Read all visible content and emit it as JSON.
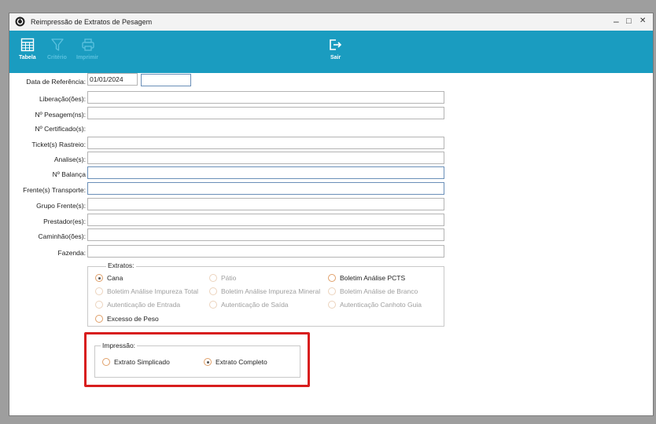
{
  "window": {
    "title": "Reimpressão de Extratos de Pesagem",
    "controls": {
      "minimize": "–",
      "maximize": "□",
      "close": "✕"
    }
  },
  "toolbar": {
    "tabela": "Tabela",
    "criterio": "Critério",
    "imprimir": "Imprimir",
    "sair": "Sair"
  },
  "form": {
    "data_referencia": {
      "label": "Data de Referência:",
      "value": "01/01/2024",
      "value2": ""
    },
    "liberacoes": {
      "label": "Liberação(ões):",
      "value": ""
    },
    "pesagens": {
      "label": "Nº Pesagem(ns):",
      "value": ""
    },
    "certificados": {
      "label": "Nº Certificado(s):"
    },
    "tickets": {
      "label": "Ticket(s) Rastreio:",
      "value": ""
    },
    "analises": {
      "label": "Analise(s):",
      "value": ""
    },
    "balanca": {
      "label": "Nº Balança",
      "value": ""
    },
    "frentes": {
      "label": "Frente(s) Transporte:",
      "value": ""
    },
    "grupo_frentes": {
      "label": "Grupo Frente(s):",
      "value": ""
    },
    "prestadores": {
      "label": "Prestador(es):",
      "value": ""
    },
    "caminhoes": {
      "label": "Caminhão(ões):",
      "value": ""
    },
    "fazenda": {
      "label": "Fazenda:",
      "value": ""
    }
  },
  "extratos": {
    "legend": "Extratos:",
    "options": [
      {
        "label": "Cana",
        "selected": true,
        "enabled": true
      },
      {
        "label": "Pátio",
        "selected": false,
        "enabled": false
      },
      {
        "label": "Boletim Análise PCTS",
        "selected": false,
        "enabled": true
      },
      {
        "label": "Boletim Análise Impureza Total",
        "selected": false,
        "enabled": false
      },
      {
        "label": "Boletim Análise Impureza Mineral",
        "selected": false,
        "enabled": false
      },
      {
        "label": "Boletim Análise de Branco",
        "selected": false,
        "enabled": false
      },
      {
        "label": "Autenticação de Entrada",
        "selected": false,
        "enabled": false
      },
      {
        "label": "Autenticação de Saída",
        "selected": false,
        "enabled": false
      },
      {
        "label": "Autenticação Canhoto Guia",
        "selected": false,
        "enabled": false
      },
      {
        "label": "Excesso de Peso",
        "selected": false,
        "enabled": true
      }
    ]
  },
  "impressao": {
    "legend": "Impressão:",
    "options": [
      {
        "label": "Extrato Simplicado",
        "selected": false
      },
      {
        "label": "Extrato Completo",
        "selected": true
      }
    ]
  },
  "colors": {
    "toolbar": "#1a9cc0",
    "highlight": "#d81e1e",
    "radio_border": "#e0a06a"
  }
}
